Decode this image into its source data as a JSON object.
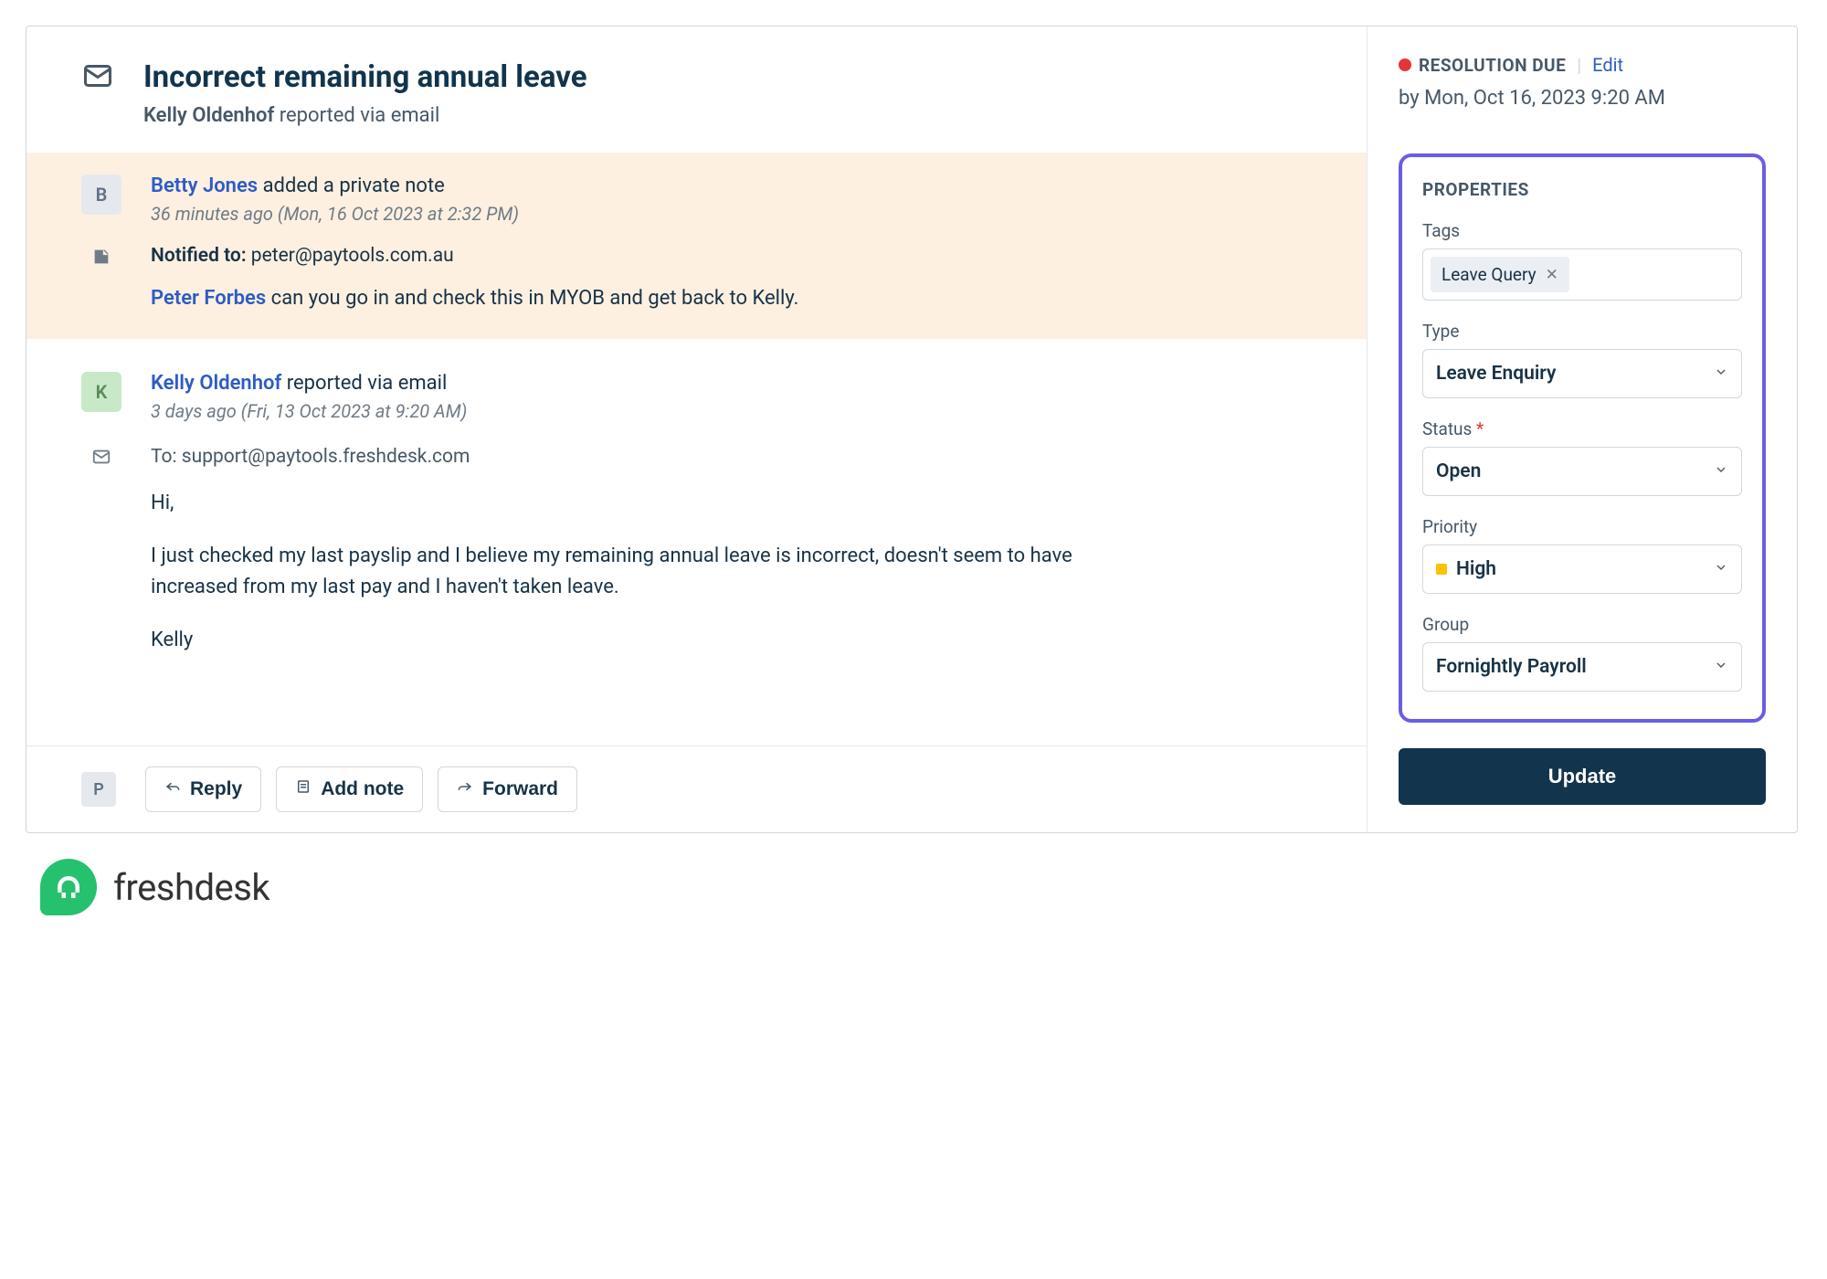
{
  "ticket": {
    "title": "Incorrect remaining annual leave",
    "reporter": "Kelly Oldenhof",
    "reporter_via": "reported via email"
  },
  "note": {
    "avatar_letter": "B",
    "author": "Betty Jones",
    "action": "added a private note",
    "relative_time": "36 minutes ago",
    "abs_time": "(Mon, 16 Oct 2023 at 2:32 PM)",
    "notified_label": "Notified to:",
    "notified_email": "peter@paytools.com.au",
    "mention": "Peter Forbes",
    "text": "can you go in and check this in MYOB and get back to Kelly."
  },
  "message": {
    "avatar_letter": "K",
    "author": "Kelly Oldenhof",
    "via": "reported via email",
    "relative_time": "3 days ago",
    "abs_time": "(Fri, 13 Oct 2023 at 9:20 AM)",
    "to_label": "To:",
    "to_email": "support@paytools.freshdesk.com",
    "greeting": "Hi,",
    "body": "I just checked my last payslip and I believe my remaining annual leave is incorrect, doesn't seem to have increased from my last pay and I haven't taken leave.",
    "signoff": "Kelly"
  },
  "actions": {
    "avatar_letter": "P",
    "reply": "Reply",
    "add_note": "Add note",
    "forward": "Forward"
  },
  "resolution": {
    "label": "RESOLUTION DUE",
    "edit": "Edit",
    "due": "by Mon, Oct 16, 2023 9:20 AM"
  },
  "properties": {
    "title": "PROPERTIES",
    "tags_label": "Tags",
    "tag": "Leave Query",
    "type_label": "Type",
    "type_value": "Leave Enquiry",
    "status_label": "Status",
    "status_value": "Open",
    "priority_label": "Priority",
    "priority_value": "High",
    "group_label": "Group",
    "group_value": "Fornightly Payroll",
    "update": "Update"
  },
  "brand": "freshdesk"
}
